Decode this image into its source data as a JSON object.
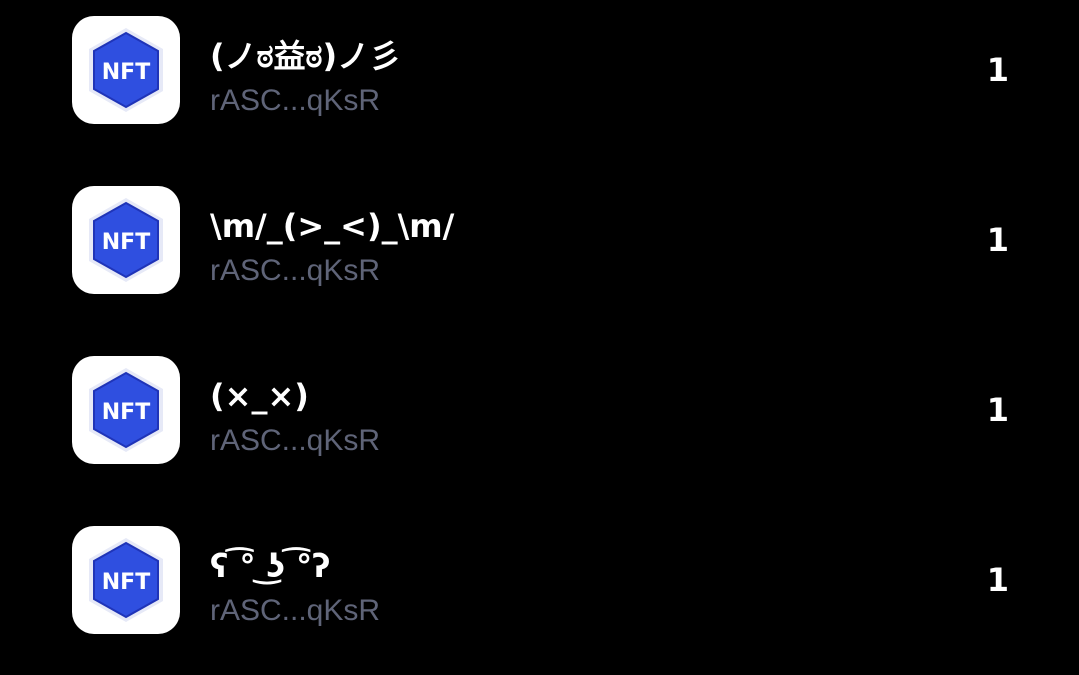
{
  "nft_list": {
    "items": [
      {
        "name": "(ノಠ益ಠ)ノ彡",
        "address": "rASC...qKsR",
        "count": "1",
        "icon": "nft-icon",
        "icon_label": "NFT"
      },
      {
        "name": "\\m/_(>_<)_\\m/",
        "address": "rASC...qKsR",
        "count": "1",
        "icon": "nft-icon",
        "icon_label": "NFT"
      },
      {
        "name": "(×_×)",
        "address": "rASC...qKsR",
        "count": "1",
        "icon": "nft-icon",
        "icon_label": "NFT"
      },
      {
        "name": "ʕ ͡° ͜ʖ ͡°ʔ",
        "address": "rASC...qKsR",
        "count": "1",
        "icon": "nft-icon",
        "icon_label": "NFT"
      }
    ]
  },
  "colors": {
    "background": "#000000",
    "text_primary": "#ffffff",
    "text_secondary": "#5f6478",
    "nft_blue": "#2f4fe0",
    "nft_blue_dark": "#1f34b8"
  }
}
